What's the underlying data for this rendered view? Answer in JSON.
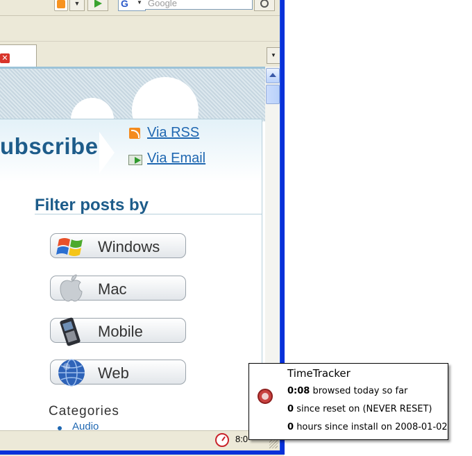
{
  "browser": {
    "search_placeholder": "Google",
    "search_engine_letter": "G",
    "tab_close_glyph": "✕",
    "tab_list_glyph": "▼",
    "dropdown_glyph": "▼"
  },
  "page": {
    "subscribe_heading": "ubscribe",
    "via_rss": "Via RSS",
    "via_email": "Via Email",
    "filter_heading": "Filter posts by",
    "filters": [
      {
        "label": "Windows",
        "icon": "windows-logo"
      },
      {
        "label": "Mac",
        "icon": "apple-logo"
      },
      {
        "label": "Mobile",
        "icon": "mobile-phone"
      },
      {
        "label": "Web",
        "icon": "globe"
      }
    ],
    "categories_heading": "Categories",
    "first_category": "Audio"
  },
  "statusbar": {
    "time": "8:0"
  },
  "tooltip": {
    "title": "TimeTracker",
    "today_value": "0:08",
    "today_text": "browsed today so far",
    "reset_value": "0",
    "reset_text": "since reset on (NEVER RESET)",
    "install_value": "0",
    "install_text": "hours since install on 2008-01-02"
  },
  "colors": {
    "heading_blue": "#1d5c8a",
    "link_blue": "#1f67b1",
    "window_frame": "#0831d9"
  }
}
